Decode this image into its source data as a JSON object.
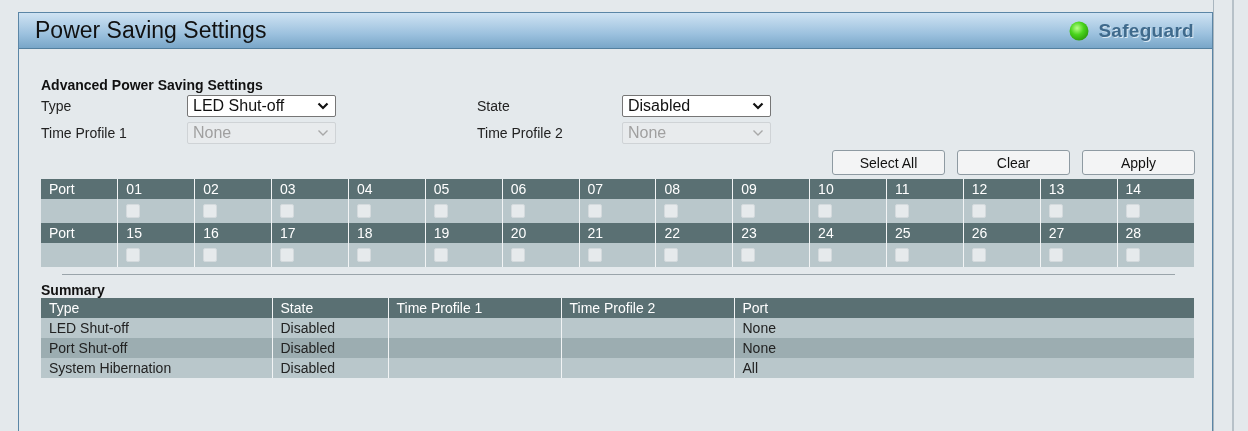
{
  "header": {
    "title": "Power Saving Settings",
    "status_label": "Safeguard"
  },
  "settings": {
    "title": "Advanced Power Saving Settings",
    "fields": [
      {
        "label": "Type",
        "value": "LED Shut-off",
        "disabled": false
      },
      {
        "label": "State",
        "value": "Disabled",
        "disabled": false
      },
      {
        "label": "Time Profile 1",
        "value": "None",
        "disabled": true
      },
      {
        "label": "Time Profile 2",
        "value": "None",
        "disabled": true
      }
    ]
  },
  "buttons": [
    "Select All",
    "Clear",
    "Apply"
  ],
  "port_groups": [
    {
      "header": "Port",
      "ports": [
        {
          "label": "01",
          "checked": false
        },
        {
          "label": "02",
          "checked": false
        },
        {
          "label": "03",
          "checked": false
        },
        {
          "label": "04",
          "checked": false
        },
        {
          "label": "05",
          "checked": false
        },
        {
          "label": "06",
          "checked": false
        },
        {
          "label": "07",
          "checked": false
        },
        {
          "label": "08",
          "checked": false
        },
        {
          "label": "09",
          "checked": false
        },
        {
          "label": "10",
          "checked": false
        },
        {
          "label": "11",
          "checked": false
        },
        {
          "label": "12",
          "checked": false
        },
        {
          "label": "13",
          "checked": false
        },
        {
          "label": "14",
          "checked": false
        }
      ]
    },
    {
      "header": "Port",
      "ports": [
        {
          "label": "15",
          "checked": false
        },
        {
          "label": "16",
          "checked": false
        },
        {
          "label": "17",
          "checked": false
        },
        {
          "label": "18",
          "checked": false
        },
        {
          "label": "19",
          "checked": false
        },
        {
          "label": "20",
          "checked": false
        },
        {
          "label": "21",
          "checked": false
        },
        {
          "label": "22",
          "checked": false
        },
        {
          "label": "23",
          "checked": false
        },
        {
          "label": "24",
          "checked": false
        },
        {
          "label": "25",
          "checked": false
        },
        {
          "label": "26",
          "checked": false
        },
        {
          "label": "27",
          "checked": false
        },
        {
          "label": "28",
          "checked": false
        }
      ]
    }
  ],
  "summary": {
    "title": "Summary",
    "columns": [
      "Type",
      "State",
      "Time Profile 1",
      "Time Profile 2",
      "Port"
    ],
    "rows": [
      {
        "type": "LED Shut-off",
        "state": "Disabled",
        "port": "None"
      },
      {
        "type": "Port Shut-off",
        "state": "Disabled",
        "port": "None"
      },
      {
        "type": "System Hibernation",
        "state": "Disabled",
        "port": "All"
      }
    ]
  }
}
